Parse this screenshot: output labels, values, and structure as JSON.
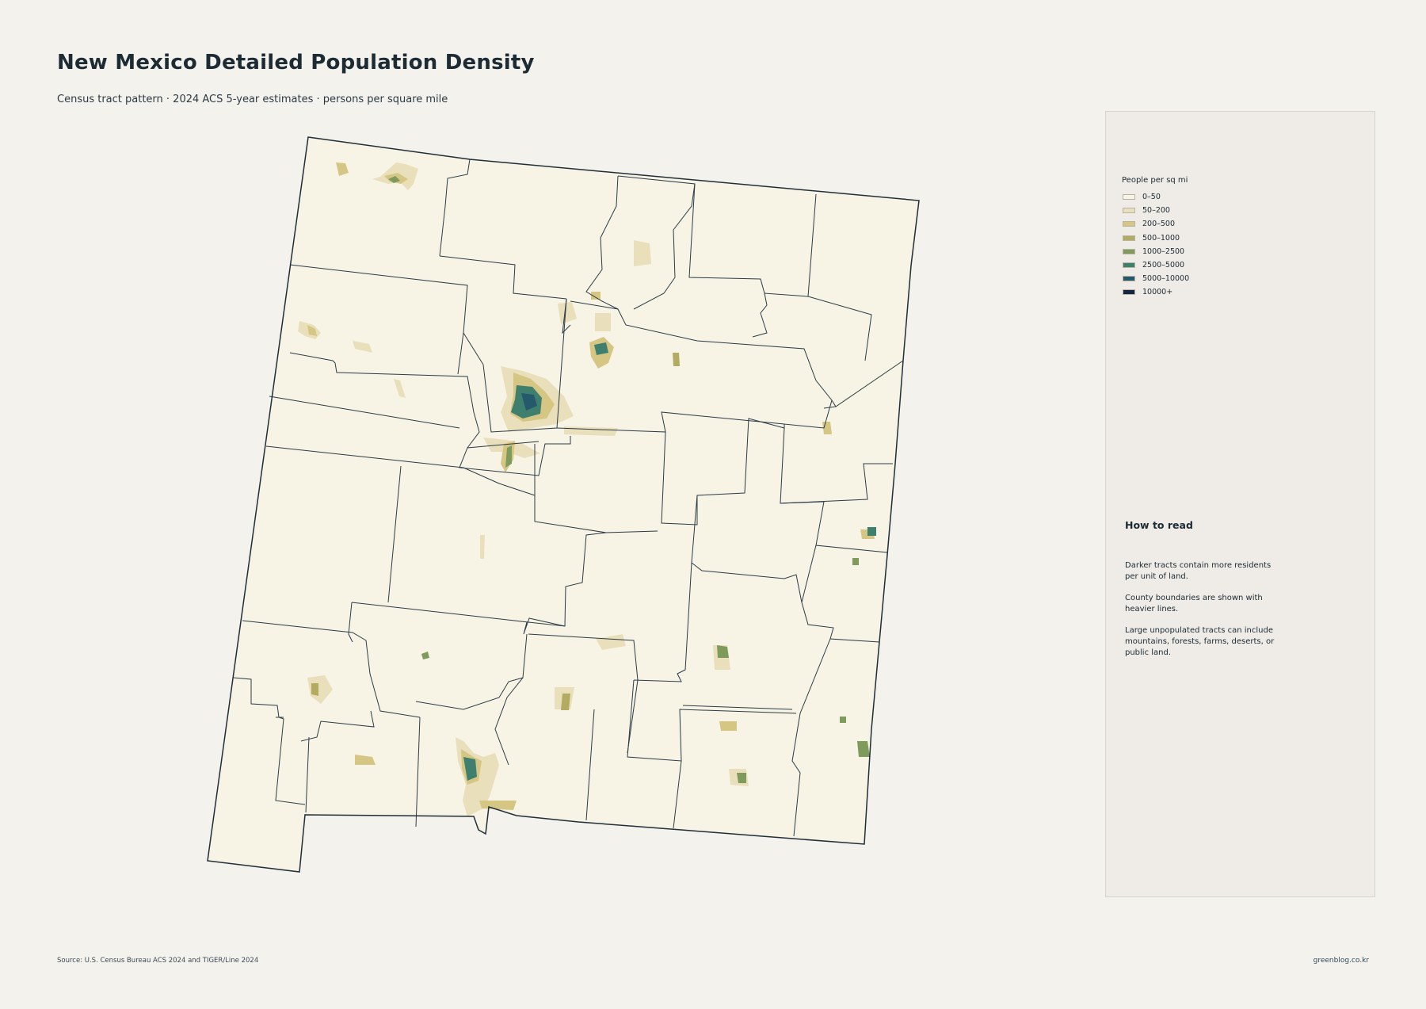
{
  "title": "New Mexico Detailed Population Density",
  "subtitle": "Census tract pattern · 2024 ACS 5-year estimates · persons per square mile",
  "legend": {
    "title": "People per sq mi",
    "items": [
      {
        "label": "0–50",
        "color": "#f7f4e6"
      },
      {
        "label": "50–200",
        "color": "#eadfbb"
      },
      {
        "label": "200–500",
        "color": "#d5c783"
      },
      {
        "label": "500–1000",
        "color": "#b4ab62"
      },
      {
        "label": "1000–2500",
        "color": "#7f9b5c"
      },
      {
        "label": "2500–5000",
        "color": "#3f7f6d"
      },
      {
        "label": "5000–10000",
        "color": "#25596b"
      },
      {
        "label": "10000+",
        "color": "#14263f"
      }
    ]
  },
  "how_to_read": {
    "title": "How to read",
    "paragraphs": [
      "Darker tracts contain more residents per unit of land.",
      "County boundaries are shown with heavier lines.",
      "Large unpopulated tracts can include mountains, forests, farms, deserts, or public land."
    ]
  },
  "source": "Source: U.S. Census Bureau ACS 2024 and TIGER/Line 2024",
  "credit": "greenblog.co.kr",
  "colors": {
    "background": "#f4f2ed",
    "state_fill": "#f7f4e6",
    "boundary": "#2b3b46",
    "panel": "#efebe6"
  }
}
